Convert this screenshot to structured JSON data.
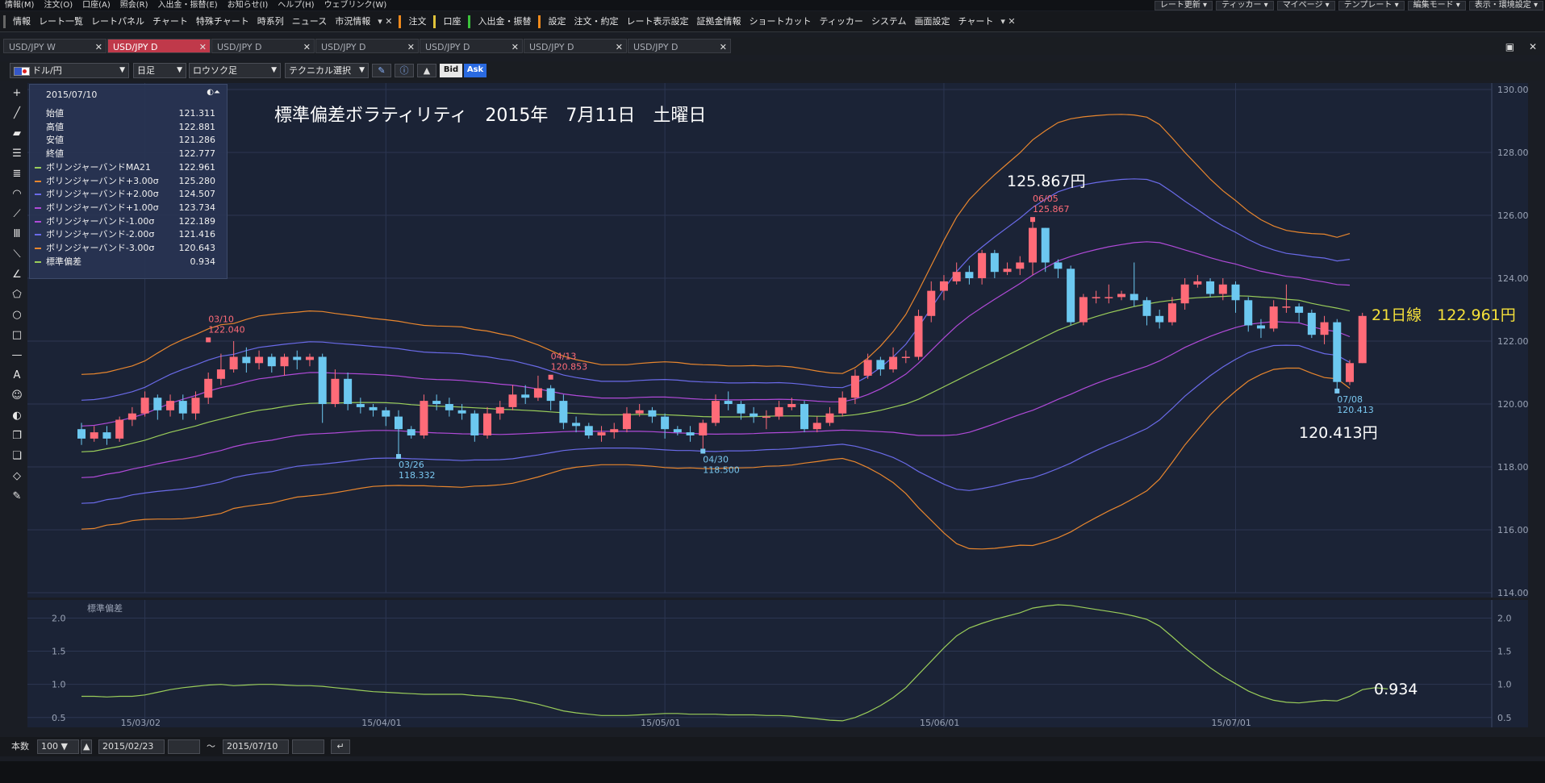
{
  "menu": {
    "items": [
      "情報(M)",
      "注文(O)",
      "口座(A)",
      "照会(R)",
      "入出金・振替(E)",
      "お知らせ(I)",
      "ヘルプ(H)",
      "ウェブリンク(W)"
    ],
    "right_items": [
      "レート更新",
      "ティッカー",
      "マイページ",
      "テンプレート",
      "編集モード",
      "表示・環境設定"
    ]
  },
  "toolbar": {
    "items": [
      "情報",
      "レート一覧",
      "レートパネル",
      "チャート",
      "特殊チャート",
      "時系列",
      "ニュース",
      "市況情報",
      "注文",
      "口座",
      "入出金・振替",
      "設定",
      "注文・約定",
      "レート表示設定",
      "証拠金情報",
      "ショートカット",
      "ティッカー",
      "システム",
      "画面設定",
      "チャート"
    ]
  },
  "tabs": [
    {
      "label": "USD/JPY W",
      "active": false
    },
    {
      "label": "USD/JPY D",
      "active": true
    },
    {
      "label": "USD/JPY D",
      "active": false
    },
    {
      "label": "USD/JPY D",
      "active": false
    },
    {
      "label": "USD/JPY D",
      "active": false
    },
    {
      "label": "USD/JPY D",
      "active": false
    },
    {
      "label": "USD/JPY D",
      "active": false
    }
  ],
  "chart_toolbar": {
    "currency": "ドル/円",
    "period": "日足",
    "chart_type": "ロウソク足",
    "technical": "テクニカル選択",
    "bid": "Bid",
    "ask": "Ask"
  },
  "info": {
    "date": "2015/07/10",
    "rows": [
      {
        "label": "始値",
        "value": "121.311",
        "color": ""
      },
      {
        "label": "高値",
        "value": "122.881",
        "color": ""
      },
      {
        "label": "安値",
        "value": "121.286",
        "color": ""
      },
      {
        "label": "終値",
        "value": "122.777",
        "color": ""
      },
      {
        "label": "ボリンジャーバンドMA21",
        "value": "122.961",
        "color": "#9acd5a"
      },
      {
        "label": "ボリンジャーバンド+3.00σ",
        "value": "125.280",
        "color": "#e8862e"
      },
      {
        "label": "ボリンジャーバンド+2.00σ",
        "value": "124.507",
        "color": "#6a6ae8"
      },
      {
        "label": "ボリンジャーバンド+1.00σ",
        "value": "123.734",
        "color": "#b04ad8"
      },
      {
        "label": "ボリンジャーバンド-1.00σ",
        "value": "122.189",
        "color": "#b04ad8"
      },
      {
        "label": "ボリンジャーバンド-2.00σ",
        "value": "121.416",
        "color": "#6a6ae8"
      },
      {
        "label": "ボリンジャーバンド-3.00σ",
        "value": "120.643",
        "color": "#e8862e"
      },
      {
        "label": "標準偏差",
        "value": "0.934",
        "color": "#9acd5a"
      }
    ]
  },
  "annotations": {
    "title": "標準偏差ボラティリティ　2015年　7月11日　土曜日",
    "high_price": "125.867円",
    "low_price": "120.413円",
    "ma_label": "21日線　122.961円",
    "sd_value": "0.934"
  },
  "chart_data": [
    {
      "type": "candlestick",
      "title": "",
      "ylim": [
        114,
        130
      ],
      "y_ticks": [
        "130.00",
        "128.00",
        "126.00",
        "124.00",
        "122.00",
        "120.00",
        "118.00",
        "116.00",
        "114.00"
      ],
      "x_ticks": [
        "15/03/02",
        "15/04/01",
        "15/05/01",
        "15/06/01",
        "15/07/01"
      ],
      "markers": [
        {
          "date": "03/10",
          "value": "122.040"
        },
        {
          "date": "03/26",
          "value": "118.332"
        },
        {
          "date": "04/13",
          "value": "120.853"
        },
        {
          "date": "04/30",
          "value": "118.500"
        },
        {
          "date": "06/05",
          "value": "125.867"
        },
        {
          "date": "07/08",
          "value": "120.413"
        }
      ],
      "candles": [
        [
          119.2,
          118.9,
          119.4,
          118.7
        ],
        [
          118.9,
          119.1,
          119.3,
          118.8
        ],
        [
          119.1,
          118.9,
          119.3,
          118.7
        ],
        [
          118.9,
          119.5,
          119.6,
          118.8
        ],
        [
          119.5,
          119.7,
          119.9,
          119.3
        ],
        [
          119.7,
          120.2,
          120.4,
          119.6
        ],
        [
          120.2,
          119.8,
          120.3,
          119.5
        ],
        [
          119.8,
          120.1,
          120.3,
          119.6
        ],
        [
          120.1,
          119.7,
          120.3,
          119.5
        ],
        [
          119.7,
          120.2,
          120.4,
          119.5
        ],
        [
          120.2,
          120.8,
          121.0,
          120.0
        ],
        [
          120.8,
          121.1,
          121.6,
          120.6
        ],
        [
          121.1,
          121.5,
          122.0,
          121.0
        ],
        [
          121.5,
          121.3,
          121.8,
          121.0
        ],
        [
          121.3,
          121.5,
          121.7,
          121.1
        ],
        [
          121.5,
          121.2,
          121.6,
          121.0
        ],
        [
          121.2,
          121.5,
          121.6,
          120.9
        ],
        [
          121.5,
          121.4,
          121.7,
          121.1
        ],
        [
          121.4,
          121.5,
          121.6,
          121.2
        ],
        [
          121.5,
          120.0,
          121.6,
          119.4
        ],
        [
          120.0,
          120.8,
          121.1,
          119.9
        ],
        [
          120.8,
          120.0,
          121.0,
          119.8
        ],
        [
          120.0,
          119.9,
          120.2,
          119.7
        ],
        [
          119.9,
          119.8,
          120.0,
          119.6
        ],
        [
          119.8,
          119.6,
          119.9,
          119.3
        ],
        [
          119.6,
          119.2,
          119.8,
          118.3
        ],
        [
          119.2,
          119.0,
          119.3,
          118.9
        ],
        [
          119.0,
          120.1,
          120.3,
          118.9
        ],
        [
          120.1,
          120.0,
          120.3,
          119.8
        ],
        [
          120.0,
          119.8,
          120.2,
          119.6
        ],
        [
          119.8,
          119.7,
          120.0,
          119.5
        ],
        [
          119.7,
          119.0,
          119.8,
          118.8
        ],
        [
          119.0,
          119.7,
          119.9,
          118.9
        ],
        [
          119.7,
          119.9,
          120.1,
          119.5
        ],
        [
          119.9,
          120.3,
          120.6,
          119.8
        ],
        [
          120.3,
          120.2,
          120.6,
          120.0
        ],
        [
          120.2,
          120.5,
          120.9,
          120.1
        ],
        [
          120.5,
          120.1,
          120.6,
          119.8
        ],
        [
          120.1,
          119.4,
          120.3,
          119.2
        ],
        [
          119.4,
          119.3,
          119.6,
          119.1
        ],
        [
          119.3,
          119.0,
          119.4,
          118.9
        ],
        [
          119.0,
          119.1,
          119.3,
          118.8
        ],
        [
          119.1,
          119.2,
          119.4,
          118.9
        ],
        [
          119.2,
          119.7,
          119.9,
          119.1
        ],
        [
          119.7,
          119.8,
          120.0,
          119.6
        ],
        [
          119.8,
          119.6,
          119.9,
          119.4
        ],
        [
          119.6,
          119.2,
          119.7,
          118.9
        ],
        [
          119.2,
          119.1,
          119.3,
          119.0
        ],
        [
          119.1,
          119.0,
          119.3,
          118.8
        ],
        [
          119.0,
          119.4,
          119.5,
          118.5
        ],
        [
          119.4,
          120.1,
          120.3,
          119.3
        ],
        [
          120.1,
          120.0,
          120.4,
          119.8
        ],
        [
          120.0,
          119.7,
          120.1,
          119.5
        ],
        [
          119.7,
          119.6,
          119.9,
          119.4
        ],
        [
          119.6,
          119.6,
          119.8,
          119.2
        ],
        [
          119.6,
          119.9,
          120.1,
          119.5
        ],
        [
          119.9,
          120.0,
          120.2,
          119.8
        ],
        [
          120.0,
          119.2,
          120.1,
          119.1
        ],
        [
          119.2,
          119.4,
          119.6,
          119.1
        ],
        [
          119.4,
          119.7,
          119.9,
          119.3
        ],
        [
          119.7,
          120.2,
          120.4,
          119.6
        ],
        [
          120.2,
          120.9,
          121.1,
          120.0
        ],
        [
          120.9,
          121.4,
          121.6,
          120.8
        ],
        [
          121.4,
          121.1,
          121.5,
          120.9
        ],
        [
          121.1,
          121.5,
          121.8,
          121.0
        ],
        [
          121.5,
          121.5,
          121.7,
          121.3
        ],
        [
          121.5,
          122.8,
          123.0,
          121.4
        ],
        [
          122.8,
          123.6,
          123.9,
          122.6
        ],
        [
          123.6,
          123.9,
          124.1,
          123.3
        ],
        [
          123.9,
          124.2,
          124.5,
          123.8
        ],
        [
          124.2,
          124.0,
          124.4,
          123.8
        ],
        [
          124.0,
          124.8,
          124.9,
          123.8
        ],
        [
          124.8,
          124.2,
          124.9,
          124.0
        ],
        [
          124.2,
          124.3,
          124.5,
          124.1
        ],
        [
          124.3,
          124.5,
          124.7,
          124.1
        ],
        [
          124.5,
          125.6,
          125.9,
          124.1
        ],
        [
          125.6,
          124.5,
          125.6,
          124.2
        ],
        [
          124.5,
          124.3,
          124.6,
          124.0
        ],
        [
          124.3,
          122.6,
          124.4,
          122.5
        ],
        [
          122.6,
          123.4,
          123.5,
          122.5
        ],
        [
          123.4,
          123.4,
          123.6,
          123.2
        ],
        [
          123.4,
          123.4,
          123.8,
          123.2
        ],
        [
          123.4,
          123.5,
          123.6,
          123.3
        ],
        [
          123.5,
          123.3,
          124.5,
          123.1
        ],
        [
          123.3,
          122.8,
          123.4,
          122.5
        ],
        [
          122.8,
          122.6,
          123.0,
          122.4
        ],
        [
          122.6,
          123.2,
          123.4,
          122.5
        ],
        [
          123.2,
          123.8,
          124.0,
          123.0
        ],
        [
          123.8,
          123.9,
          124.1,
          123.7
        ],
        [
          123.9,
          123.5,
          124.0,
          123.4
        ],
        [
          123.5,
          123.8,
          124.0,
          123.3
        ],
        [
          123.8,
          123.3,
          123.9,
          122.9
        ],
        [
          123.3,
          122.5,
          123.4,
          122.3
        ],
        [
          122.5,
          122.4,
          122.7,
          122.1
        ],
        [
          122.4,
          123.1,
          123.3,
          122.3
        ],
        [
          123.1,
          123.1,
          123.8,
          122.9
        ],
        [
          123.1,
          122.9,
          123.2,
          122.6
        ],
        [
          122.9,
          122.2,
          123.0,
          122.1
        ],
        [
          122.2,
          122.6,
          122.8,
          121.9
        ],
        [
          122.6,
          120.7,
          122.7,
          120.4
        ],
        [
          120.7,
          121.3,
          121.4,
          120.6
        ],
        [
          121.3,
          122.8,
          122.9,
          121.3
        ]
      ],
      "bollinger": {
        "ma21": [
          118.48,
          118.5,
          118.58,
          118.65,
          118.75,
          118.85,
          118.98,
          119.1,
          119.2,
          119.3,
          119.42,
          119.52,
          119.62,
          119.72,
          119.8,
          119.85,
          119.92,
          119.98,
          120.02,
          120.03,
          120.03,
          120.04,
          120.05,
          120.05,
          120.04,
          120.02,
          119.98,
          119.95,
          119.93,
          119.92,
          119.9,
          119.88,
          119.86,
          119.83,
          119.82,
          119.8,
          119.78,
          119.75,
          119.72,
          119.7,
          119.68,
          119.66,
          119.66,
          119.66,
          119.67,
          119.67,
          119.66,
          119.64,
          119.62,
          119.6,
          119.59,
          119.59,
          119.59,
          119.6,
          119.61,
          119.62,
          119.62,
          119.62,
          119.61,
          119.61,
          119.62,
          119.66,
          119.72,
          119.8,
          119.9,
          120.0,
          120.15,
          120.35,
          120.55,
          120.75,
          120.95,
          121.15,
          121.35,
          121.55,
          121.75,
          121.95,
          122.15,
          122.35,
          122.5,
          122.65,
          122.78,
          122.9,
          123.0,
          123.1,
          123.18,
          123.25,
          123.3,
          123.35,
          123.38,
          123.4,
          123.42,
          123.44,
          123.43,
          123.4,
          123.38,
          123.33,
          123.3,
          123.2,
          123.12,
          123.05,
          122.96
        ],
        "sd": [
          0.82,
          0.82,
          0.81,
          0.82,
          0.82,
          0.84,
          0.88,
          0.92,
          0.95,
          0.97,
          0.99,
          1.0,
          0.98,
          0.99,
          1.0,
          1.0,
          0.99,
          0.98,
          0.98,
          0.97,
          0.95,
          0.93,
          0.91,
          0.89,
          0.88,
          0.87,
          0.86,
          0.85,
          0.85,
          0.85,
          0.85,
          0.83,
          0.82,
          0.8,
          0.78,
          0.74,
          0.7,
          0.65,
          0.6,
          0.57,
          0.55,
          0.53,
          0.53,
          0.53,
          0.54,
          0.55,
          0.56,
          0.56,
          0.55,
          0.55,
          0.55,
          0.54,
          0.54,
          0.54,
          0.53,
          0.53,
          0.52,
          0.5,
          0.48,
          0.46,
          0.45,
          0.5,
          0.58,
          0.68,
          0.8,
          0.95,
          1.15,
          1.35,
          1.55,
          1.73,
          1.85,
          1.92,
          1.98,
          2.03,
          2.08,
          2.15,
          2.18,
          2.2,
          2.19,
          2.16,
          2.13,
          2.1,
          2.07,
          2.03,
          1.98,
          1.88,
          1.72,
          1.55,
          1.4,
          1.25,
          1.12,
          1.01,
          0.9,
          0.82,
          0.76,
          0.73,
          0.72,
          0.74,
          0.76,
          0.75,
          0.82,
          0.92,
          0.95,
          0.93
        ]
      }
    },
    {
      "type": "line",
      "title": "標準偏差",
      "ylim": [
        0.4,
        2.2
      ],
      "y_ticks": [
        "2.0",
        "1.5",
        "1.0",
        "0.5"
      ]
    }
  ],
  "bottombar": {
    "count_label": "本数",
    "count_value": "100",
    "from_date": "2015/02/23",
    "tilde": "～",
    "to_date": "2015/07/10"
  }
}
